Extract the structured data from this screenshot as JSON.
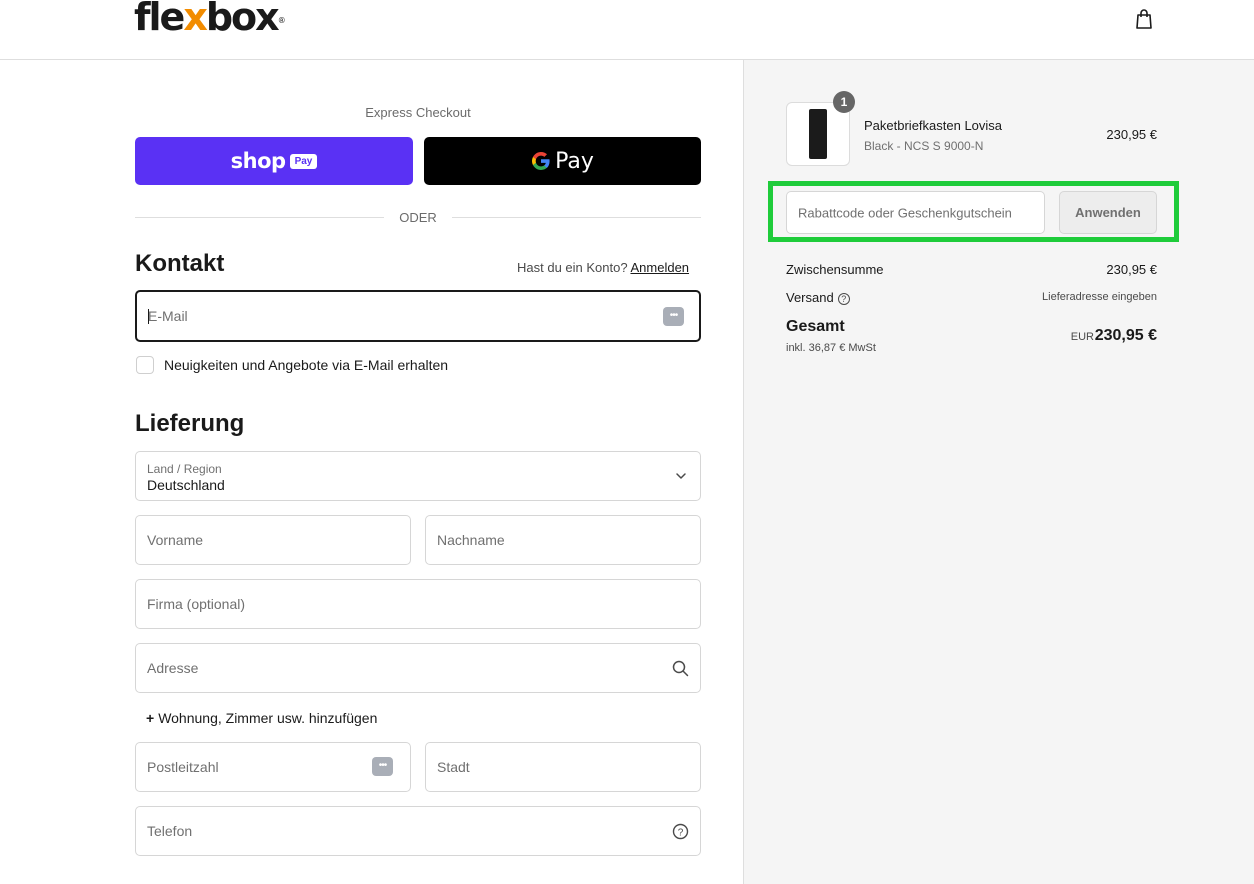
{
  "header": {
    "logo_pre": "fle",
    "logo_x": "x",
    "logo_post": "box",
    "logo_reg": "®",
    "cart_icon": "shopping-bag-icon"
  },
  "express": {
    "label": "Express Checkout",
    "shoppay_word": "shop",
    "shoppay_badge": "Pay",
    "gpay_text": "Pay",
    "separator": "ODER"
  },
  "contact": {
    "title": "Kontakt",
    "account_question": "Hast du ein Konto?",
    "login_link": "Anmelden",
    "email_placeholder": "E-Mail",
    "newsletter_label": "Neuigkeiten und Angebote via E-Mail erhalten"
  },
  "delivery": {
    "title": "Lieferung",
    "country_label": "Land / Region",
    "country_value": "Deutschland",
    "firstname_placeholder": "Vorname",
    "lastname_placeholder": "Nachname",
    "company_placeholder": "Firma (optional)",
    "address_placeholder": "Adresse",
    "add_apartment": "Wohnung, Zimmer usw. hinzufügen",
    "zip_placeholder": "Postleitzahl",
    "city_placeholder": "Stadt",
    "phone_placeholder": "Telefon"
  },
  "summary": {
    "product": {
      "quantity": "1",
      "name": "Paketbriefkasten Lovisa",
      "variant": "Black - NCS S 9000-N",
      "price": "230,95 €"
    },
    "discount_placeholder": "Rabattcode oder Geschenkgutschein",
    "apply_label": "Anwenden",
    "subtotal_label": "Zwischensumme",
    "subtotal_value": "230,95 €",
    "shipping_label": "Versand",
    "shipping_value": "Lieferadresse eingeben",
    "total_label": "Gesamt",
    "tax_note": "inkl. 36,87 € MwSt",
    "currency": "EUR",
    "total_value": "230,95 €"
  },
  "colors": {
    "shoppay": "#5a31f4",
    "gpay": "#000000",
    "logo_accent": "#f28c00",
    "highlight": "#1ecc3a"
  }
}
